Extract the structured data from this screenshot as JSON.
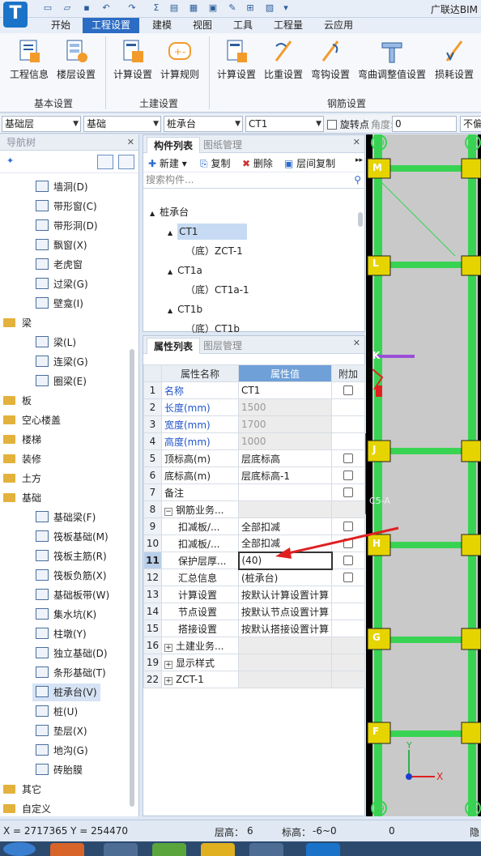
{
  "app": {
    "title": "广联达BIM",
    "logo": "T"
  },
  "menu": {
    "tabs": [
      "开始",
      "工程设置",
      "建模",
      "视图",
      "工具",
      "工程量",
      "云应用"
    ],
    "active": "工程设置"
  },
  "ribbon": {
    "groups": [
      {
        "label": "基本设置",
        "buttons": [
          "工程信息",
          "楼层设置"
        ]
      },
      {
        "label": "土建设置",
        "buttons": [
          "计算设置",
          "计算规则"
        ]
      },
      {
        "label": "钢筋设置",
        "buttons": [
          "计算设置",
          "比重设置",
          "弯钩设置",
          "弯曲调整值设置",
          "损耗设置"
        ]
      }
    ]
  },
  "filterbar": {
    "floor": "基础层",
    "category": "基础",
    "type": "桩承台",
    "component": "CT1",
    "rotate_label": "旋转点",
    "angle_label": "角度:",
    "angle_value": "0",
    "last_label": "不偏"
  },
  "nav": {
    "title": "导航树",
    "items": [
      {
        "label": "墙洞(D)",
        "icon": "wall-hole-icon",
        "level": 2
      },
      {
        "label": "带形窗(C)",
        "icon": "strip-window-icon",
        "level": 2
      },
      {
        "label": "带形洞(D)",
        "icon": "strip-hole-icon",
        "level": 2
      },
      {
        "label": "飘窗(X)",
        "icon": "bay-window-icon",
        "level": 2
      },
      {
        "label": "老虎窗",
        "icon": "dormer-icon",
        "level": 2
      },
      {
        "label": "过梁(G)",
        "icon": "lintel-icon",
        "level": 2
      },
      {
        "label": "壁龛(I)",
        "icon": "niche-icon",
        "level": 2
      },
      {
        "label": "梁",
        "icon": "folder-icon",
        "level": 1
      },
      {
        "label": "梁(L)",
        "icon": "beam-icon",
        "level": 2
      },
      {
        "label": "连梁(G)",
        "icon": "link-beam-icon",
        "level": 2
      },
      {
        "label": "圈梁(E)",
        "icon": "ring-beam-icon",
        "level": 2
      },
      {
        "label": "板",
        "icon": "folder-icon",
        "level": 1
      },
      {
        "label": "空心楼盖",
        "icon": "folder-icon",
        "level": 1
      },
      {
        "label": "楼梯",
        "icon": "folder-icon",
        "level": 1
      },
      {
        "label": "装修",
        "icon": "folder-icon",
        "level": 1
      },
      {
        "label": "土方",
        "icon": "folder-icon",
        "level": 1
      },
      {
        "label": "基础",
        "icon": "folder-icon",
        "level": 1
      },
      {
        "label": "基础梁(F)",
        "icon": "foundation-beam-icon",
        "level": 2
      },
      {
        "label": "筏板基础(M)",
        "icon": "raft-foundation-icon",
        "level": 2
      },
      {
        "label": "筏板主筋(R)",
        "icon": "raft-main-rebar-icon",
        "level": 2
      },
      {
        "label": "筏板负筋(X)",
        "icon": "raft-negative-rebar-icon",
        "level": 2
      },
      {
        "label": "基础板带(W)",
        "icon": "foundation-strip-icon",
        "level": 2
      },
      {
        "label": "集水坑(K)",
        "icon": "sump-pit-icon",
        "level": 2
      },
      {
        "label": "柱墩(Y)",
        "icon": "column-pier-icon",
        "level": 2
      },
      {
        "label": "独立基础(D)",
        "icon": "isolated-footing-icon",
        "level": 2
      },
      {
        "label": "条形基础(T)",
        "icon": "strip-footing-icon",
        "level": 2
      },
      {
        "label": "桩承台(V)",
        "icon": "pile-cap-icon",
        "level": 2,
        "selected": true
      },
      {
        "label": "桩(U)",
        "icon": "pile-icon",
        "level": 2
      },
      {
        "label": "垫层(X)",
        "icon": "cushion-icon",
        "level": 2
      },
      {
        "label": "地沟(G)",
        "icon": "trench-icon",
        "level": 2
      },
      {
        "label": "砖胎膜",
        "icon": "brick-mold-icon",
        "level": 2
      },
      {
        "label": "其它",
        "icon": "folder-icon",
        "level": 1
      },
      {
        "label": "自定义",
        "icon": "folder-icon",
        "level": 1
      }
    ]
  },
  "components": {
    "tabs": [
      "构件列表",
      "图纸管理"
    ],
    "toolbar": [
      "新建",
      "复制",
      "删除",
      "层间复制"
    ],
    "search_placeholder": "搜索构件...",
    "tree": [
      {
        "label": "桩承台",
        "level": 0,
        "expand": "▲"
      },
      {
        "label": "CT1",
        "level": 1,
        "expand": "▲",
        "selected": true
      },
      {
        "label": "（底）ZCT-1",
        "level": 2
      },
      {
        "label": "CT1a",
        "level": 1,
        "expand": "▲"
      },
      {
        "label": "（底）CT1a-1",
        "level": 2
      },
      {
        "label": "CT1b",
        "level": 1,
        "expand": "▲"
      },
      {
        "label": "（底）CT1b",
        "level": 2
      }
    ]
  },
  "properties": {
    "tabs": [
      "属性列表",
      "图层管理"
    ],
    "headers": [
      "属性名称",
      "属性值",
      "附加"
    ],
    "rows": [
      {
        "num": "1",
        "name": "名称",
        "value": "CT1",
        "blue": true,
        "check": true
      },
      {
        "num": "2",
        "name": "长度(mm)",
        "value": "1500",
        "blue": true,
        "gray": true
      },
      {
        "num": "3",
        "name": "宽度(mm)",
        "value": "1700",
        "blue": true,
        "gray": true
      },
      {
        "num": "4",
        "name": "高度(mm)",
        "value": "1000",
        "blue": true,
        "gray": true
      },
      {
        "num": "5",
        "name": "顶标高(m)",
        "value": "层底标高",
        "check": true
      },
      {
        "num": "6",
        "name": "底标高(m)",
        "value": "层底标高-1",
        "check": true
      },
      {
        "num": "7",
        "name": "备注",
        "value": "",
        "check": true
      },
      {
        "num": "8",
        "name": "钢筋业务...",
        "value": "",
        "expand": "−",
        "group": true
      },
      {
        "num": "9",
        "name": "扣减板/...",
        "value": "全部扣减",
        "indent": true,
        "check": true
      },
      {
        "num": "10",
        "name": "扣减板/...",
        "value": "全部扣减",
        "indent": true,
        "check": true
      },
      {
        "num": "11",
        "name": "保护层厚...",
        "value": "(40)",
        "indent": true,
        "check": true,
        "active": true
      },
      {
        "num": "12",
        "name": "汇总信息",
        "value": "(桩承台)",
        "indent": true,
        "check": true
      },
      {
        "num": "13",
        "name": "计算设置",
        "value": "按默认计算设置计算",
        "indent": true
      },
      {
        "num": "14",
        "name": "节点设置",
        "value": "按默认节点设置计算",
        "indent": true
      },
      {
        "num": "15",
        "name": "搭接设置",
        "value": "按默认搭接设置计算",
        "indent": true
      },
      {
        "num": "16",
        "name": "土建业务...",
        "value": "",
        "expand": "+",
        "group": true
      },
      {
        "num": "19",
        "name": "显示样式",
        "value": "",
        "expand": "+",
        "group": true
      },
      {
        "num": "22",
        "name": "ZCT-1",
        "value": "",
        "expand": "+",
        "group": true
      }
    ]
  },
  "canvas": {
    "axis_labels_left": [
      "M",
      "L",
      "K",
      "J",
      "H",
      "G",
      "F"
    ],
    "grid_top": "39",
    "grid_bottom": "39",
    "tags": [
      "C5-A"
    ],
    "coord_labels": [
      "X",
      "Y"
    ]
  },
  "status": {
    "coords": "X = 2717365 Y = 254470",
    "floor_height_label": "层高：",
    "floor_height": "6",
    "elevation_label": "标高：",
    "elevation": "-6~0",
    "count": "0",
    "last": "隐"
  },
  "colors": {
    "accent": "#2b6cc4",
    "grid_green": "#39d353",
    "pile_yellow": "#e5d400",
    "arrow_red": "#e02020"
  }
}
